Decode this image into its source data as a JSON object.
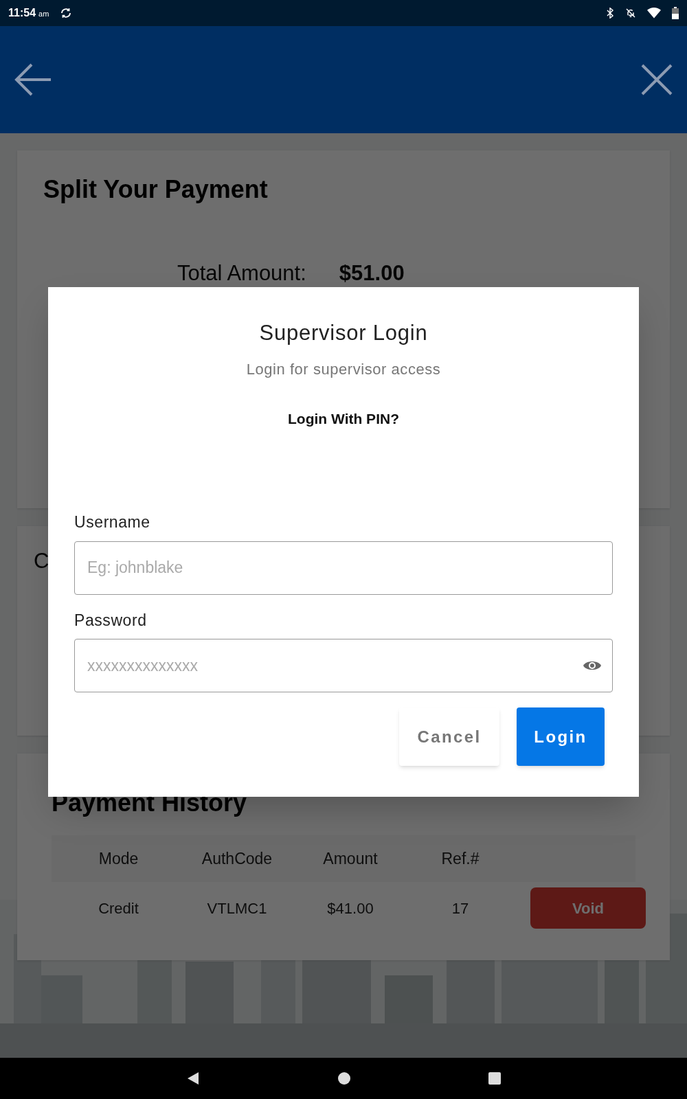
{
  "status_bar": {
    "time": "11:54",
    "ampm": "am"
  },
  "split_card": {
    "title": "Split Your Payment",
    "total_label": "Total Amount:",
    "total_value": "$51.00"
  },
  "second_card": {
    "title": "C"
  },
  "history_card": {
    "title": "Payment History",
    "columns": [
      "Mode",
      "AuthCode",
      "Amount",
      "Ref.#"
    ],
    "rows": [
      {
        "cells": [
          "Credit",
          "VTLMC1",
          "$41.00",
          "17"
        ],
        "action": "Void"
      }
    ]
  },
  "dialog": {
    "title": "Supervisor Login",
    "subtitle": "Login for supervisor access",
    "pin_link": "Login With PIN?",
    "fields": [
      {
        "label": "Username",
        "placeholder": "Eg: johnblake",
        "kind": "text"
      },
      {
        "label": "Password",
        "placeholder": "xxxxxxxxxxxxxx",
        "kind": "password"
      }
    ],
    "buttons": [
      {
        "label": "Cancel",
        "kind": "secondary"
      },
      {
        "label": "Login",
        "kind": "primary"
      }
    ]
  }
}
